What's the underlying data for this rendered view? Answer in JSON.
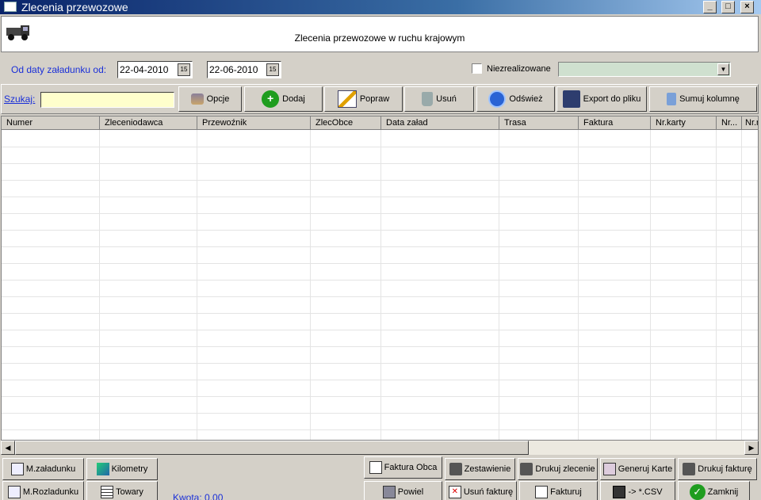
{
  "window": {
    "title": "Zlecenia przewozowe"
  },
  "header": {
    "heading": "Zlecenia przewozowe w ruchu krajowym"
  },
  "filter": {
    "date_label": "Od daty załadunku od:",
    "date_from": "22-04-2010",
    "date_to": "22-06-2010",
    "calendar_glyph": "15",
    "unrealized_label": "Niezrealizowane",
    "unrealized_checked": false,
    "combo_value": ""
  },
  "toolbar": {
    "search_label": "Szukaj:",
    "search_value": "",
    "opcje": "Opcje",
    "dodaj": "Dodaj",
    "popraw": "Popraw",
    "usun": "Usuń",
    "odswiez": "Odśwież",
    "export": "Export do pliku",
    "sumuj": "Sumuj kolumnę"
  },
  "grid": {
    "columns": [
      "Numer",
      "Zleceniodawca",
      "Przewoźnik",
      "ZlecObce",
      "Data załad",
      "Trasa",
      "Faktura",
      "Nr.karty",
      "Nr...",
      "Nr.r"
    ],
    "rows": []
  },
  "bottom": {
    "m_zaladunku": "M.załadunku",
    "kilometry": "Kilometry",
    "m_rozladunku": "M.Rozladunku",
    "towary": "Towary",
    "kwota": "Kwota:  0.00",
    "faktura_obca": "Faktura Obca",
    "zestawienie": "Zestawienie",
    "drukuj_zlecenie": "Drukuj zlecenie",
    "generuj_karte": "Generuj Karte",
    "drukuj_fakture": "Drukuj fakturę",
    "powiel": "Powiel",
    "usun_fakture": "Usuń fakturę",
    "fakturuj": "Fakturuj",
    "csv": "-> *.CSV",
    "zamknij": "Zamknij"
  },
  "colors": {
    "accent_blue": "#1a2fd8",
    "search_bg": "#ffffcc",
    "titlebar": "#0a246a"
  }
}
